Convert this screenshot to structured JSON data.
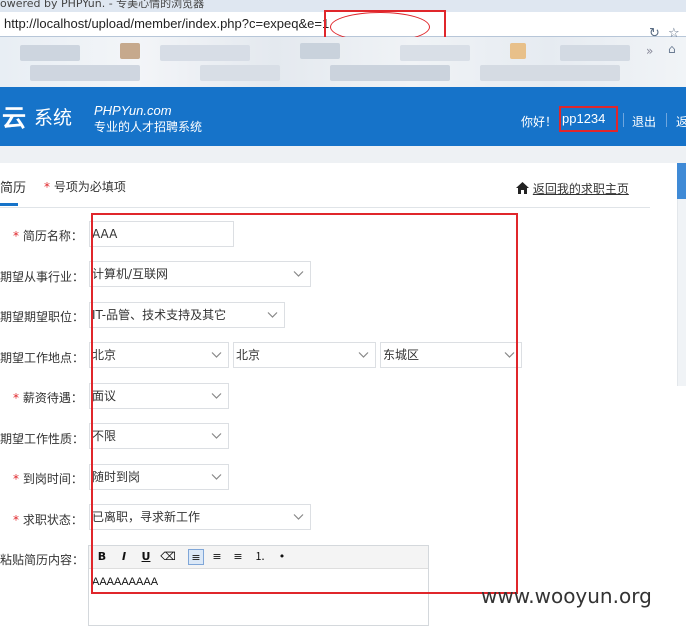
{
  "browser": {
    "title": "owered by PHPYun. - 专美心情的浏览器",
    "url": "http://localhost/upload/member/index.php?c=expect&e=1",
    "url_prefix": "http://localhost/upload/member/index.php?c=expe",
    "url_suffix": "q&e=1",
    "fav_arrow": "»",
    "nav_icons": [
      "reload-icon",
      "star-icon",
      "home-icon"
    ]
  },
  "header": {
    "logo_char": "云",
    "logo_word": "系统",
    "brand_line1": "PHPYun.com",
    "brand_line2": "专业的人才招聘系统",
    "greeting": "你好！",
    "username": "pp1234",
    "logout": "退出",
    "back_partial": "返"
  },
  "tabs": {
    "active": "简历",
    "required_star": "*",
    "required_note": " 号项为必填项",
    "home_link": "返回我的求职主页"
  },
  "form": {
    "resume_name": {
      "label": "简历名称：",
      "required": true,
      "value": "AAA"
    },
    "industry": {
      "label": "期望从事行业：",
      "required": false,
      "value": "计算机/互联网"
    },
    "position": {
      "label": "期望期望职位：",
      "required": false,
      "value": "IT-品管、技术支持及其它"
    },
    "location": {
      "label": "期望工作地点：",
      "required": false,
      "province": "北京",
      "city": "北京",
      "district": "东城区"
    },
    "salary": {
      "label": "薪资待遇：",
      "required": true,
      "value": "面议"
    },
    "job_type": {
      "label": "期望工作性质：",
      "required": false,
      "value": "不限"
    },
    "start_time": {
      "label": "到岗时间：",
      "required": true,
      "value": "随时到岗"
    },
    "status": {
      "label": "求职状态：",
      "required": true,
      "value": "已离职，寻求新工作"
    },
    "paste": {
      "label": "粘贴简历内容：",
      "content": "AAAAAAAAA"
    }
  },
  "editor_toolbar": [
    "B",
    "I",
    "U",
    "⌫",
    "≡",
    "≡",
    "≡",
    "⒈",
    "•"
  ],
  "watermark": "www.wooyun.org",
  "colors": {
    "header_blue": "#1673c9",
    "annotation_red": "#e0262b",
    "required_red": "#e0262b"
  }
}
